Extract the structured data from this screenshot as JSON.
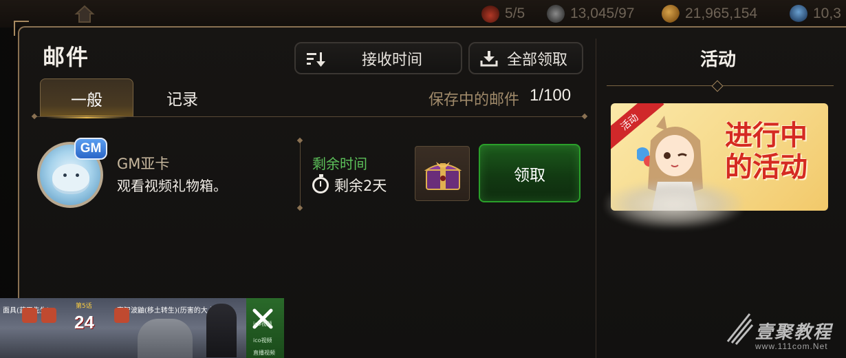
{
  "topbar": {
    "resources": [
      {
        "name": "fire",
        "value": "5/5"
      },
      {
        "name": "stamina",
        "value": "13,045/97"
      },
      {
        "name": "coins",
        "value": "21,965,154"
      },
      {
        "name": "gems",
        "value": "10,3"
      }
    ]
  },
  "mail": {
    "title": "邮件",
    "sort_button": "接收时间",
    "claim_all_button": "全部领取",
    "tabs": [
      {
        "label": "一般",
        "active": true
      },
      {
        "label": "记录",
        "active": false
      }
    ],
    "saved_label": "保存中的邮件",
    "saved_count": "1/100",
    "items": [
      {
        "badge": "GM",
        "sender": "GM亚卡",
        "subject": "观看视频礼物箱。",
        "remaining_label": "剩余时间",
        "remaining_value": "剩余2天",
        "claim_button": "领取"
      }
    ]
  },
  "side": {
    "title": "活动",
    "banner_ribbon": "活动",
    "banner_text_line1": "进行中",
    "banner_text_line2": "的活动"
  },
  "video_overlay": {
    "caption_left": "面具(蓝天先生)",
    "caption_mid": "宇智波鼬(移土转生)(历害的大人)",
    "stage_label": "第5话",
    "number": "24",
    "strip_labels": [
      "ico视频",
      "ico视频",
      "直播视频"
    ]
  },
  "watermark": {
    "name": "壹聚教程",
    "url": "www.111com.Net"
  },
  "colors": {
    "accent_gold": "#8a7152",
    "claim_green": "#2aa02a",
    "remaining_green": "#5cc05a",
    "event_red": "#d52a22"
  }
}
